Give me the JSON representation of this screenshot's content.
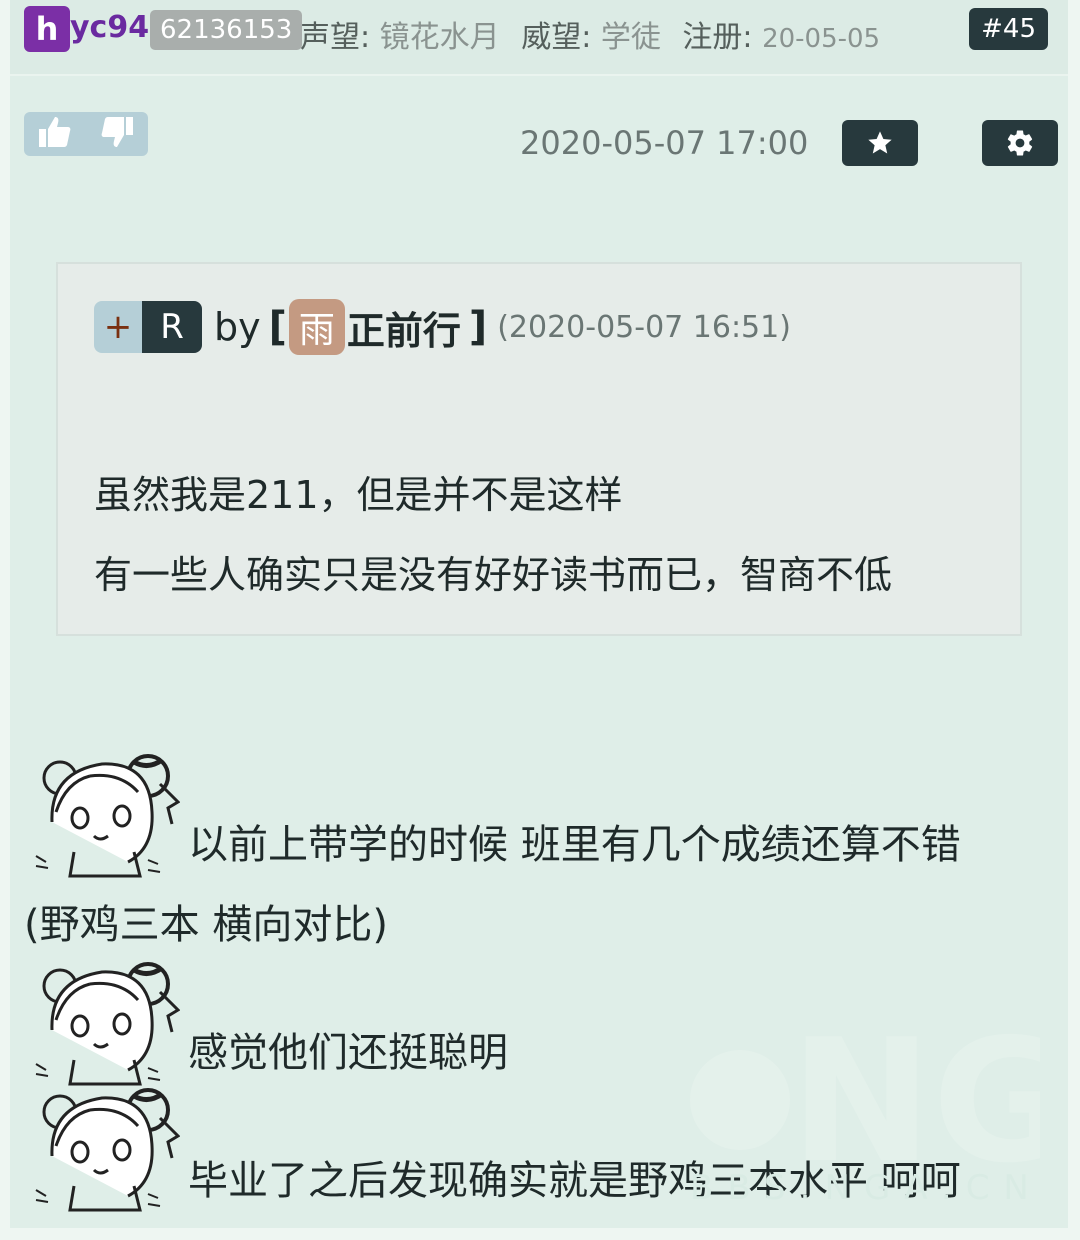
{
  "header": {
    "avatar_letter": "h",
    "username": "yc94",
    "uid": "62136153",
    "reputation_label": "声望:",
    "reputation_value": "镜花水月",
    "prestige_label": "威望:",
    "prestige_value": "学徒",
    "register_label": "注册:",
    "register_date": "20-05-05",
    "floor": "#45"
  },
  "actions": {
    "like_icon": "thumbs-up-icon",
    "dislike_icon": "thumbs-down-icon",
    "timestamp": "2020-05-07 17:00",
    "favorite_icon": "star-icon",
    "settings_icon": "gear-icon"
  },
  "quote": {
    "plus": "+",
    "reply_tag": "R",
    "by": "by",
    "open_bracket": "[",
    "name_initial": "雨",
    "name_rest": "正前行",
    "close_bracket": "]",
    "date": "(2020-05-07 16:51)",
    "lines": [
      "虽然我是211，但是并不是这样",
      "有一些人确实只是没有好好读书而已，智商不低"
    ]
  },
  "body": {
    "lines": [
      "以前上带学的时候 班里有几个成绩还算不错",
      "(野鸡三本 横向对比)",
      "感觉他们还挺聪明",
      "毕业了之后发现确实就是野鸡三本水平 呵呵"
    ],
    "sticker_icon": "anime-girl-sticker-icon"
  },
  "watermark": {
    "text": "NGA",
    "sub": "BBS.NGA.CN"
  }
}
